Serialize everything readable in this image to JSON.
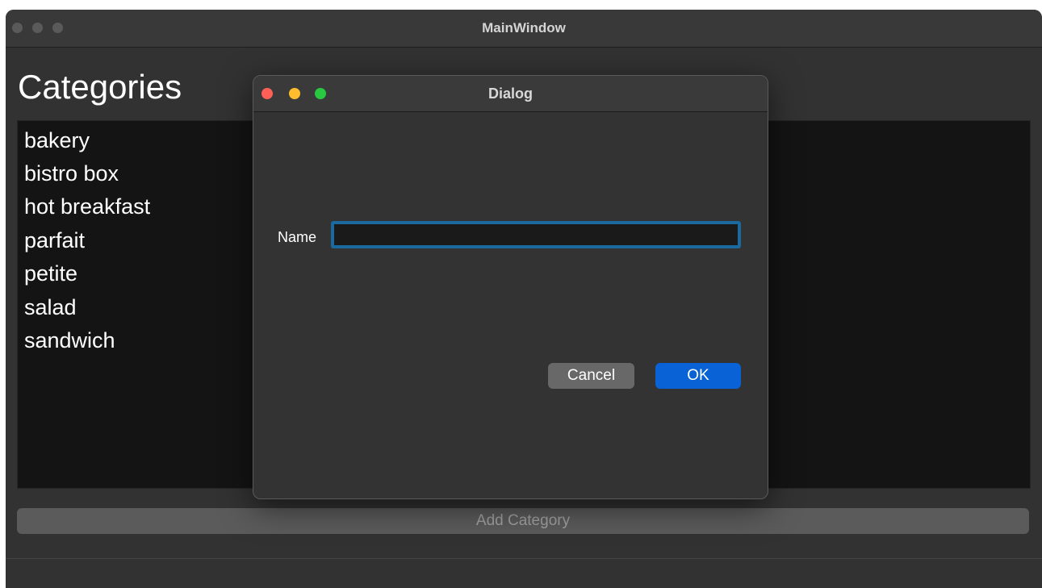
{
  "main_window": {
    "title": "MainWindow",
    "heading": "Categories",
    "categories": [
      "bakery",
      "bistro box",
      "hot breakfast",
      "parfait",
      "petite",
      "salad",
      "sandwich"
    ],
    "add_button_label": "Add Category"
  },
  "dialog": {
    "title": "Dialog",
    "name_label": "Name",
    "name_value": "",
    "cancel_label": "Cancel",
    "ok_label": "OK"
  },
  "colors": {
    "close": "#ff5f57",
    "minimize": "#febc2e",
    "zoom": "#28c840",
    "accent": "#0a63d6",
    "focus_ring": "#1a6aa0"
  }
}
